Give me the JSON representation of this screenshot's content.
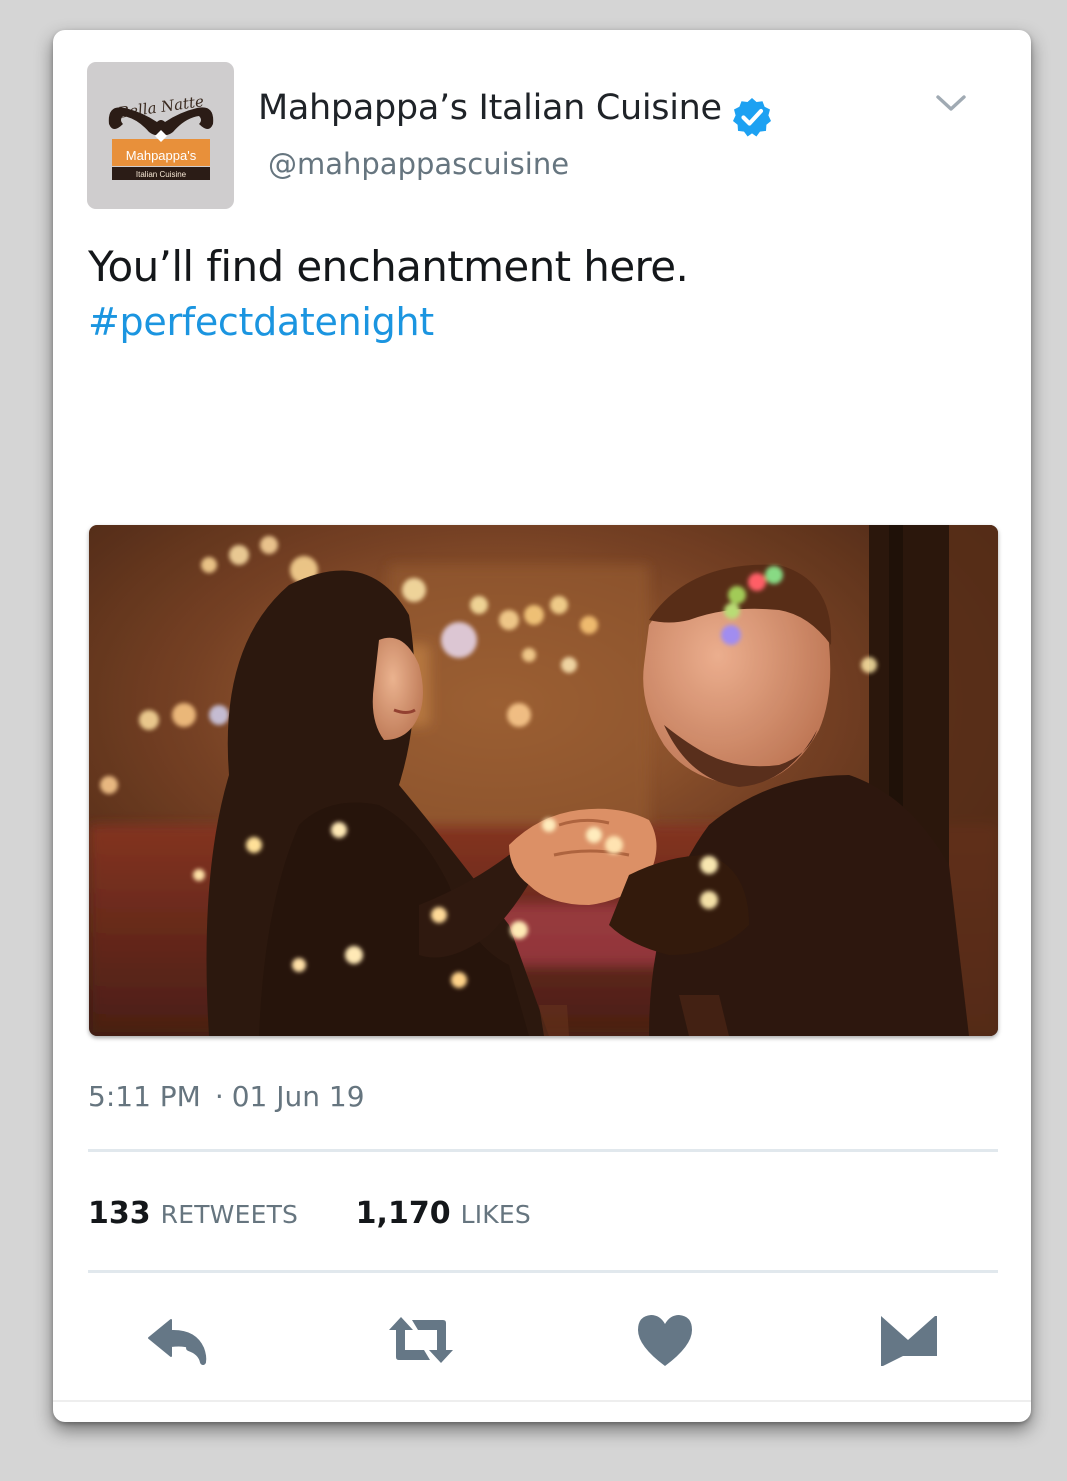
{
  "account": {
    "display_name": "Mahpappa’s Italian Cuisine",
    "handle": "@mahpappascuisine",
    "verified": true,
    "avatar": {
      "script_text": "Bella Natte",
      "brand": "Mahpappa's",
      "sub": "Italian Cuisine"
    }
  },
  "tweet": {
    "text": "You’ll find enchantment here.",
    "hashtag": "#perfectdatenight",
    "time": "5:11 PM",
    "date": "01 Jun 19",
    "separator": "·"
  },
  "stats": {
    "retweets_count": "133",
    "retweets_label": "RETWEETS",
    "likes_count": "1,170",
    "likes_label": "LIKES"
  },
  "icons": {
    "verified": "verified-badge-icon",
    "menu": "chevron-down-icon",
    "reply": "reply-icon",
    "retweet": "retweet-icon",
    "like": "heart-icon",
    "dm": "envelope-icon"
  },
  "colors": {
    "accent": "#1b95e0",
    "verified": "#1da1f2",
    "icon": "#657786",
    "text": "#14171a",
    "muted": "#66757f"
  }
}
